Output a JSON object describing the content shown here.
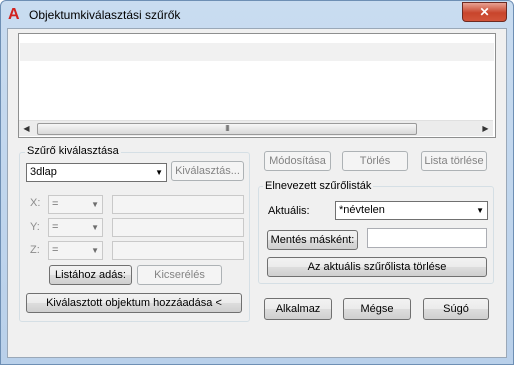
{
  "window": {
    "title": "Objektumkiválasztási szűrők",
    "close_label": "✕"
  },
  "scroll": {
    "left": "◀",
    "right": "▶",
    "grip": "III"
  },
  "filter_select": {
    "group_label": "Szűrő kiválasztása",
    "combo_value": "3dlap",
    "select_button": "Kiválasztás...",
    "x_label": "X:",
    "y_label": "Y:",
    "z_label": "Z:",
    "op_value": "=",
    "add_to_list": "Listához adás:",
    "replace": "Kicserélés",
    "add_selected": "Kiválasztott objektum hozzáadása <"
  },
  "list_actions": {
    "edit": "Módosítása",
    "delete": "Törlés",
    "clear_list": "Lista törlése"
  },
  "named_filters": {
    "group_label": "Elnevezett szűrőlisták",
    "current_label": "Aktuális:",
    "current_value": "*névtelen",
    "save_as": "Mentés másként:",
    "save_as_value": "",
    "delete_current": "Az aktuális szűrőlista törlése"
  },
  "footer": {
    "apply": "Alkalmaz",
    "cancel": "Mégse",
    "help": "Súgó"
  }
}
